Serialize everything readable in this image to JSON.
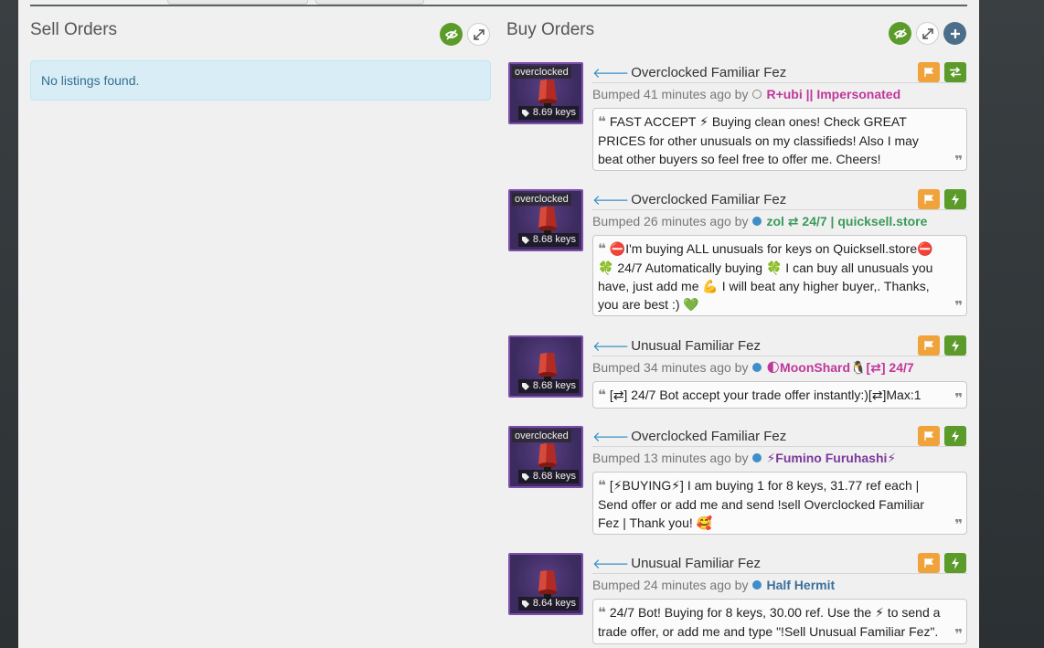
{
  "colors": {
    "accent_green": "#5b9b2a",
    "accent_orange": "#f0a23b",
    "link_blue": "#3a8fc7",
    "info_bg": "#d9edf7",
    "thumb_purple": "#3b2b5e"
  },
  "sell_orders": {
    "title": "Sell Orders",
    "empty_message": "No listings found.",
    "buttons": [
      "eye-slash-icon",
      "expand-icon"
    ]
  },
  "buy_orders": {
    "title": "Buy Orders",
    "buttons": [
      "eye-slash-icon",
      "expand-icon",
      "plus-icon"
    ],
    "listings": [
      {
        "quality_tag": "overclocked",
        "price": "8.69 keys",
        "item_name": "Overclocked Familiar Fez",
        "bumped": "Bumped 41 minutes ago by",
        "user_status": "offline",
        "user": "R+ubi || Impersonated",
        "user_color": "#c0379a",
        "action_icon": "exchange-icon",
        "comment": "FAST ACCEPT ⚡ Buying clean ones! Check GREAT PRICES for other unusuals on my classifieds! Also I may beat other buyers so feel free to offer me. Cheers!"
      },
      {
        "quality_tag": "overclocked",
        "price": "8.68 keys",
        "item_name": "Overclocked Familiar Fez",
        "bumped": "Bumped 26 minutes ago by",
        "user_status": "online",
        "user": "zol ⇄ 24/7 | quicksell.store",
        "user_color": "#3a9a5a",
        "action_icon": "lightning-icon",
        "comment": "⛔I'm buying ALL unusuals for keys on Quicksell.store⛔ 🍀 24/7 Automatically buying 🍀 I can buy all unusuals you have, just add me 💪 I will beat any higher buyer,. Thanks, you are best :) 💚"
      },
      {
        "quality_tag": "",
        "price": "8.68 keys",
        "item_name": "Unusual Familiar Fez",
        "bumped": "Bumped 34 minutes ago by",
        "user_status": "online",
        "user": "🌓MoonShard🐧[⇄] 24/7",
        "user_color": "#c0379a",
        "action_icon": "lightning-icon",
        "comment": "[⇄] 24/7 Bot accept your trade offer instantly:)[⇄]Max:1"
      },
      {
        "quality_tag": "overclocked",
        "price": "8.68 keys",
        "item_name": "Overclocked Familiar Fez",
        "bumped": "Bumped 13 minutes ago by",
        "user_status": "online",
        "user": "⚡Fumino Furuhashi⚡",
        "user_color": "#7a3a9a",
        "action_icon": "lightning-icon",
        "comment": "[⚡BUYING⚡] I am buying 1 for 8 keys, 31.77 ref each | Send offer or add me and send !sell Overclocked Familiar Fez | Thank you! 🥰"
      },
      {
        "quality_tag": "",
        "price": "8.64 keys",
        "item_name": "Unusual Familiar Fez",
        "bumped": "Bumped 24 minutes ago by",
        "user_status": "online",
        "user": "Half Hermit",
        "user_color": "#3b6f9a",
        "action_icon": "lightning-icon",
        "comment": "24/7 Bot! Buying for 8 keys, 30.00 ref. Use the ⚡ to send a trade offer, or add me and type \"!Sell Unusual Familiar Fez\"."
      }
    ]
  }
}
